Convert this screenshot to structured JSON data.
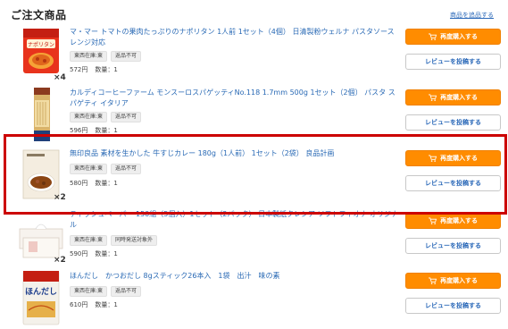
{
  "header": {
    "title": "ご注文商品",
    "link": "商品を追品する"
  },
  "buttons": {
    "buy_again": "再度購入する",
    "review": "レビューを投稿する"
  },
  "items": [
    {
      "title": "マ・マー トマトの果肉たっぷりのナポリタン 1人前 1セット（4個） 日清製粉ウェルナ パスタソース レンジ対応",
      "tags": [
        "東西在庫:東",
        "返品不可"
      ],
      "price": "572円",
      "qty": "数量：1",
      "badge": "×4",
      "package_text": "ナポリタン"
    },
    {
      "title": "カルディコーヒーファーム モンスーロスパゲッティNo.118 1.7mm 500g 1セット（2個） パスタ スパゲティ イタリア",
      "tags": [
        "東西在庫:東",
        "返品不可"
      ],
      "price": "596円",
      "qty": "数量：1",
      "badge": ""
    },
    {
      "title": "無印良品 素材を生かした 牛すじカレー 180g（1人前） 1セット（2袋） 良品計画",
      "tags": [
        "東西在庫:東",
        "返品不可"
      ],
      "price": "580円",
      "qty": "数量：1",
      "badge": "×2"
    },
    {
      "title": "ティッシュペーパー 150組（5個入）1セット（2パック） 日本製紙クレシア ソフトフィオナ オリジナル",
      "tags": [
        "東西在庫:東",
        "同時発送対象外"
      ],
      "price": "590円",
      "qty": "数量：1",
      "badge": "×2"
    },
    {
      "title": "ほんだし　かつおだし 8gスティック26本入　1袋　出汁　味の素",
      "tags": [
        "東西在庫:東",
        "返品不可"
      ],
      "price": "610円",
      "qty": "数量：1",
      "badge": "",
      "package_text": "ほんだし"
    }
  ],
  "colors": {
    "accent_orange": "#ff8c00",
    "link_blue": "#2a6ab5",
    "highlight_red": "#cc0000"
  }
}
